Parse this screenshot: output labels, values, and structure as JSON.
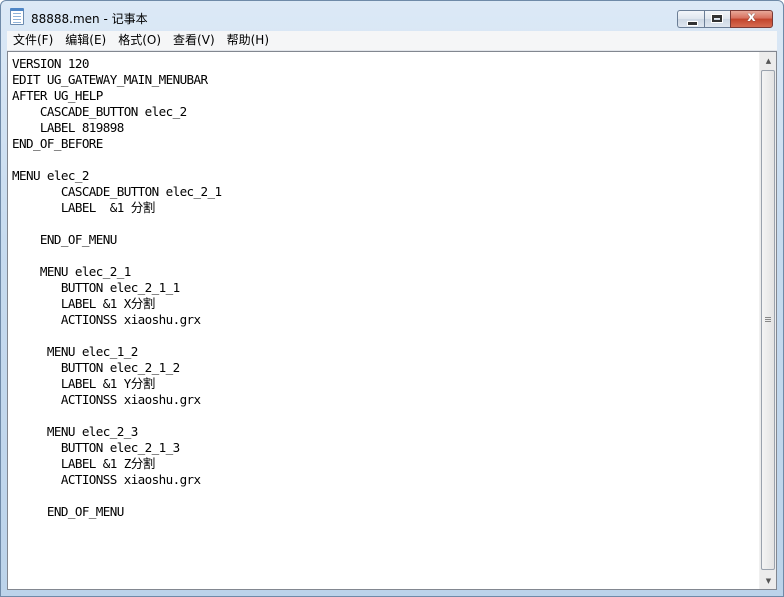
{
  "window": {
    "title": "88888.men - 记事本"
  },
  "titlebar_controls": {
    "minimize_icon": "minimize-icon",
    "maximize_icon": "maximize-icon",
    "close_glyph": "x"
  },
  "menubar": {
    "items": [
      {
        "label": "文件(F)"
      },
      {
        "label": "编辑(E)"
      },
      {
        "label": "格式(O)"
      },
      {
        "label": "查看(V)"
      },
      {
        "label": "帮助(H)"
      }
    ]
  },
  "editor": {
    "content": "VERSION 120\nEDIT UG_GATEWAY_MAIN_MENUBAR\nAFTER UG_HELP\n    CASCADE_BUTTON elec_2\n    LABEL 819898\nEND_OF_BEFORE\n\nMENU elec_2\n       CASCADE_BUTTON elec_2_1\n       LABEL  &1 分割\n\n    END_OF_MENU\n\n    MENU elec_2_1\n       BUTTON elec_2_1_1\n       LABEL &1 X分割\n       ACTIONSS xiaoshu.grx\n\n     MENU elec_1_2\n       BUTTON elec_2_1_2\n       LABEL &1 Y分割\n       ACTIONSS xiaoshu.grx\n\n     MENU elec_2_3\n       BUTTON elec_2_1_3\n       LABEL &1 Z分割\n       ACTIONSS xiaoshu.grx\n\n     END_OF_MENU"
  },
  "colors": {
    "title_bar": "#c7dbef",
    "close_button": "#c2432c",
    "menubar_bg": "#f5f6f7",
    "editor_bg": "#ffffff"
  }
}
